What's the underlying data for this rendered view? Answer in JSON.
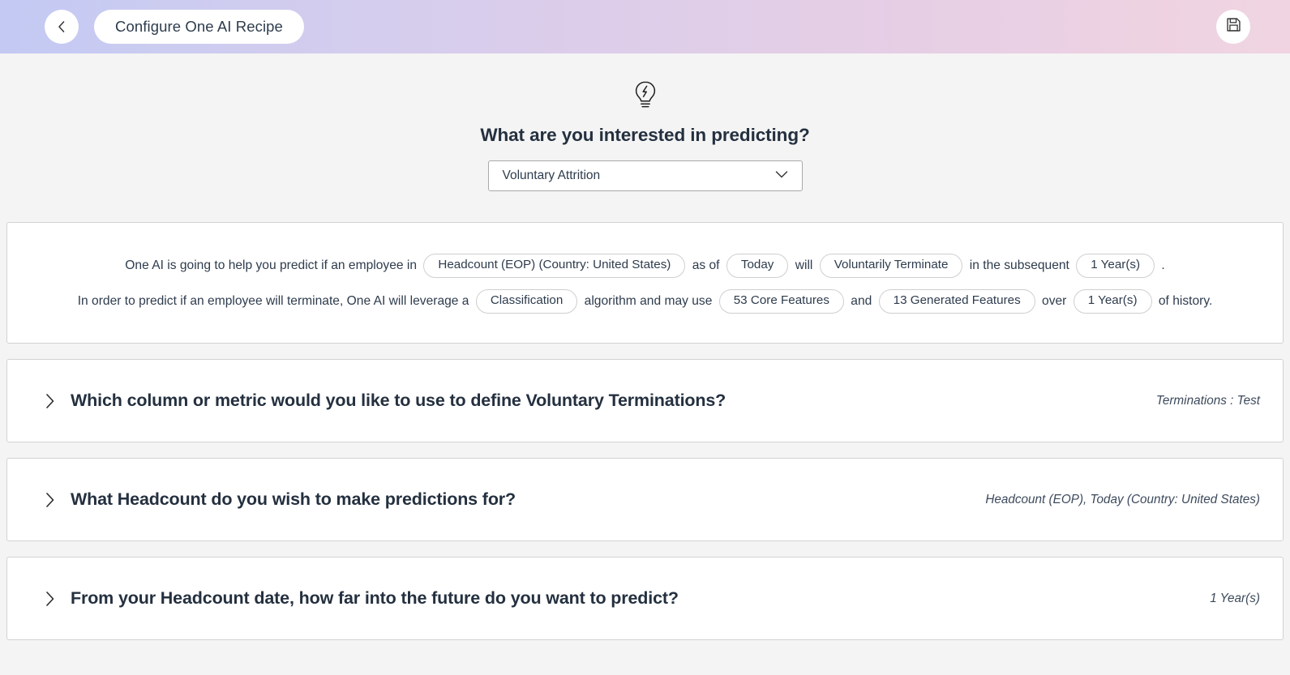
{
  "topbar": {
    "back_icon": "chevron-left-icon",
    "title": "Configure One AI Recipe",
    "save_icon": "save-floppy-icon",
    "gradient_from": "#c3c9f3",
    "gradient_to": "#f0d4e1"
  },
  "intro": {
    "icon": "lightbulb-bolt-icon",
    "headline": "What are you interested in predicting?",
    "prediction_select": {
      "value": "Voluntary Attrition",
      "placeholder": "Voluntary Attrition",
      "chevron_icon": "chevron-down-icon"
    }
  },
  "summary": {
    "line1": {
      "t1": "One AI is going to help you predict if an employee in",
      "chip1": "Headcount (EOP) (Country: United States)",
      "t2": "as of",
      "chip2": "Today",
      "t3": "will",
      "chip3": "Voluntarily Terminate",
      "t4": "in the subsequent",
      "chip4": "1 Year(s)",
      "t5": "."
    },
    "line2": {
      "t1": "In order to predict if an employee will terminate, One AI will leverage a",
      "chip1": "Classification",
      "t2": "algorithm and may use",
      "chip2": "53 Core Features",
      "t3": "and",
      "chip3": "13 Generated Features",
      "t4": "over",
      "chip4": "1 Year(s)",
      "t5": "of history."
    }
  },
  "accordions": [
    {
      "icon": "chevron-right-icon",
      "title": "Which column or metric would you like to use to define Voluntary Terminations?",
      "value": "Terminations : Test"
    },
    {
      "icon": "chevron-right-icon",
      "title": "What Headcount do you wish to make predictions for?",
      "value": "Headcount (EOP), Today (Country: United States)"
    },
    {
      "icon": "chevron-right-icon",
      "title": "From your Headcount date, how far into the future do you want to predict?",
      "value": "1 Year(s)"
    }
  ]
}
